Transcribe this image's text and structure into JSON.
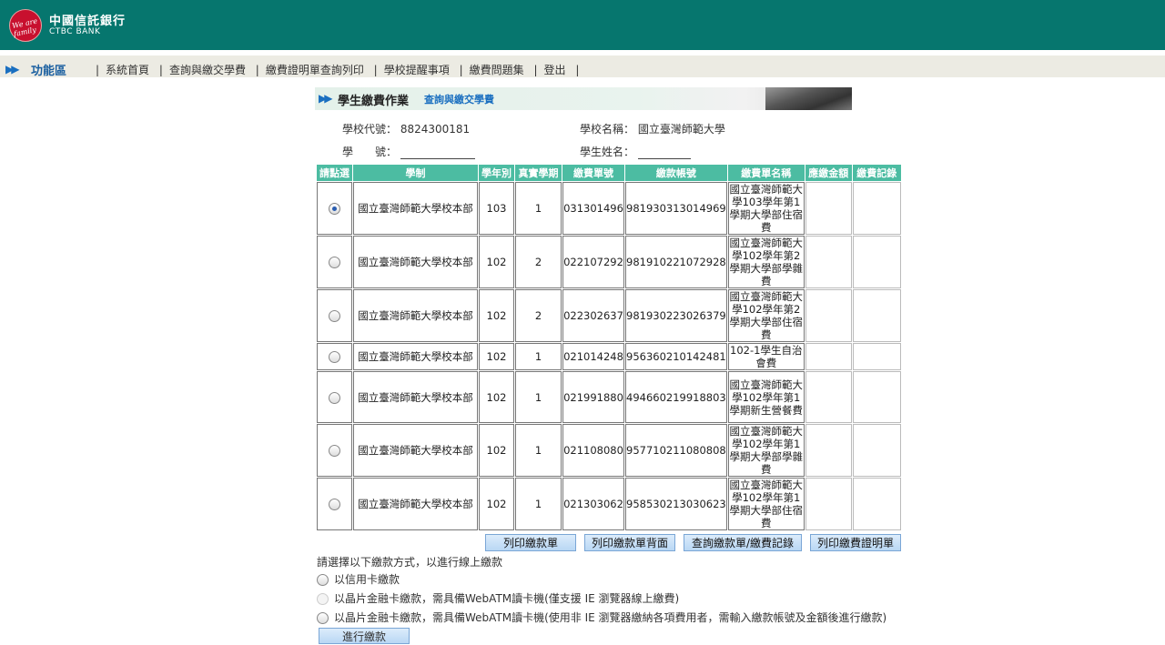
{
  "header": {
    "bank_name_cn": "中國信託銀行",
    "bank_name_en": "CTBC BANK",
    "logo_text": "We are family"
  },
  "menu": {
    "title": "功能區",
    "items": [
      "系統首頁",
      "查詢與繳交學費",
      "繳費證明單查詢列印",
      "學校提醒事項",
      "繳費問題集",
      "登出"
    ]
  },
  "banner": {
    "title": "學生繳費作業",
    "subtitle": "查詢與繳交學費"
  },
  "info": {
    "school_code_label": "學校代號：",
    "school_code": "8824300181",
    "school_name_label": "學校名稱：",
    "school_name": "國立臺灣師範大學",
    "student_id_label": "學　　號：",
    "student_id": "",
    "student_name_label": "學生姓名：",
    "student_name": ""
  },
  "table": {
    "headers": [
      "請點選",
      "學制",
      "學年別",
      "真實學期",
      "繳費單號",
      "繳款帳號",
      "繳費單名稱",
      "應繳金額",
      "繳費記錄"
    ],
    "rows": [
      {
        "selected": true,
        "school": "國立臺灣師範大學校本部",
        "year": "103",
        "term": "1",
        "bill_no": "031301496",
        "account": "981930313014969",
        "name": "國立臺灣師範大學103學年第1學期大學部住宿費",
        "amount": "",
        "record": ""
      },
      {
        "selected": false,
        "school": "國立臺灣師範大學校本部",
        "year": "102",
        "term": "2",
        "bill_no": "022107292",
        "account": "981910221072928",
        "name": "國立臺灣師範大學102學年第2學期大學部學雜費",
        "amount": "",
        "record": ""
      },
      {
        "selected": false,
        "school": "國立臺灣師範大學校本部",
        "year": "102",
        "term": "2",
        "bill_no": "022302637",
        "account": "981930223026379",
        "name": "國立臺灣師範大學102學年第2學期大學部住宿費",
        "amount": "",
        "record": ""
      },
      {
        "selected": false,
        "school": "國立臺灣師範大學校本部",
        "year": "102",
        "term": "1",
        "bill_no": "021014248",
        "account": "956360210142481",
        "name": "102-1學生自治會費",
        "amount": "",
        "record": ""
      },
      {
        "selected": false,
        "school": "國立臺灣師範大學校本部",
        "year": "102",
        "term": "1",
        "bill_no": "021991880",
        "account": "494660219918803",
        "name": "國立臺灣師範大學102學年第1學期新生營餐費",
        "amount": "",
        "record": ""
      },
      {
        "selected": false,
        "school": "國立臺灣師範大學校本部",
        "year": "102",
        "term": "1",
        "bill_no": "021108080",
        "account": "957710211080808",
        "name": "國立臺灣師範大學102學年第1學期大學部學雜費",
        "amount": "",
        "record": ""
      },
      {
        "selected": false,
        "school": "國立臺灣師範大學校本部",
        "year": "102",
        "term": "1",
        "bill_no": "021303062",
        "account": "958530213030623",
        "name": "國立臺灣師範大學102學年第1學期大學部住宿費",
        "amount": "",
        "record": ""
      }
    ]
  },
  "buttons": {
    "print_bill": "列印繳款單",
    "print_bill_back": "列印繳款單背面",
    "query_bill": "查詢繳款單/繳費記錄",
    "print_cert": "列印繳費證明單"
  },
  "payment": {
    "prompt": "請選擇以下繳款方式，以進行線上繳款",
    "options": [
      {
        "label": "以信用卡繳款",
        "enabled": true
      },
      {
        "label": "以晶片金融卡繳款，需具備WebATM讀卡機(僅支援 IE 瀏覽器線上繳費)",
        "enabled": false
      },
      {
        "label": "以晶片金融卡繳款，需具備WebATM讀卡機(使用非 IE 瀏覽器繳納各項費用者，需輸入繳款帳號及金額後進行繳款)",
        "enabled": true
      }
    ],
    "submit": "進行繳款"
  },
  "colors": {
    "header": "#06766e",
    "table_header": "#4cbca2",
    "menu_bg": "#ecebe3",
    "accent_blue": "#1a6fc0"
  }
}
